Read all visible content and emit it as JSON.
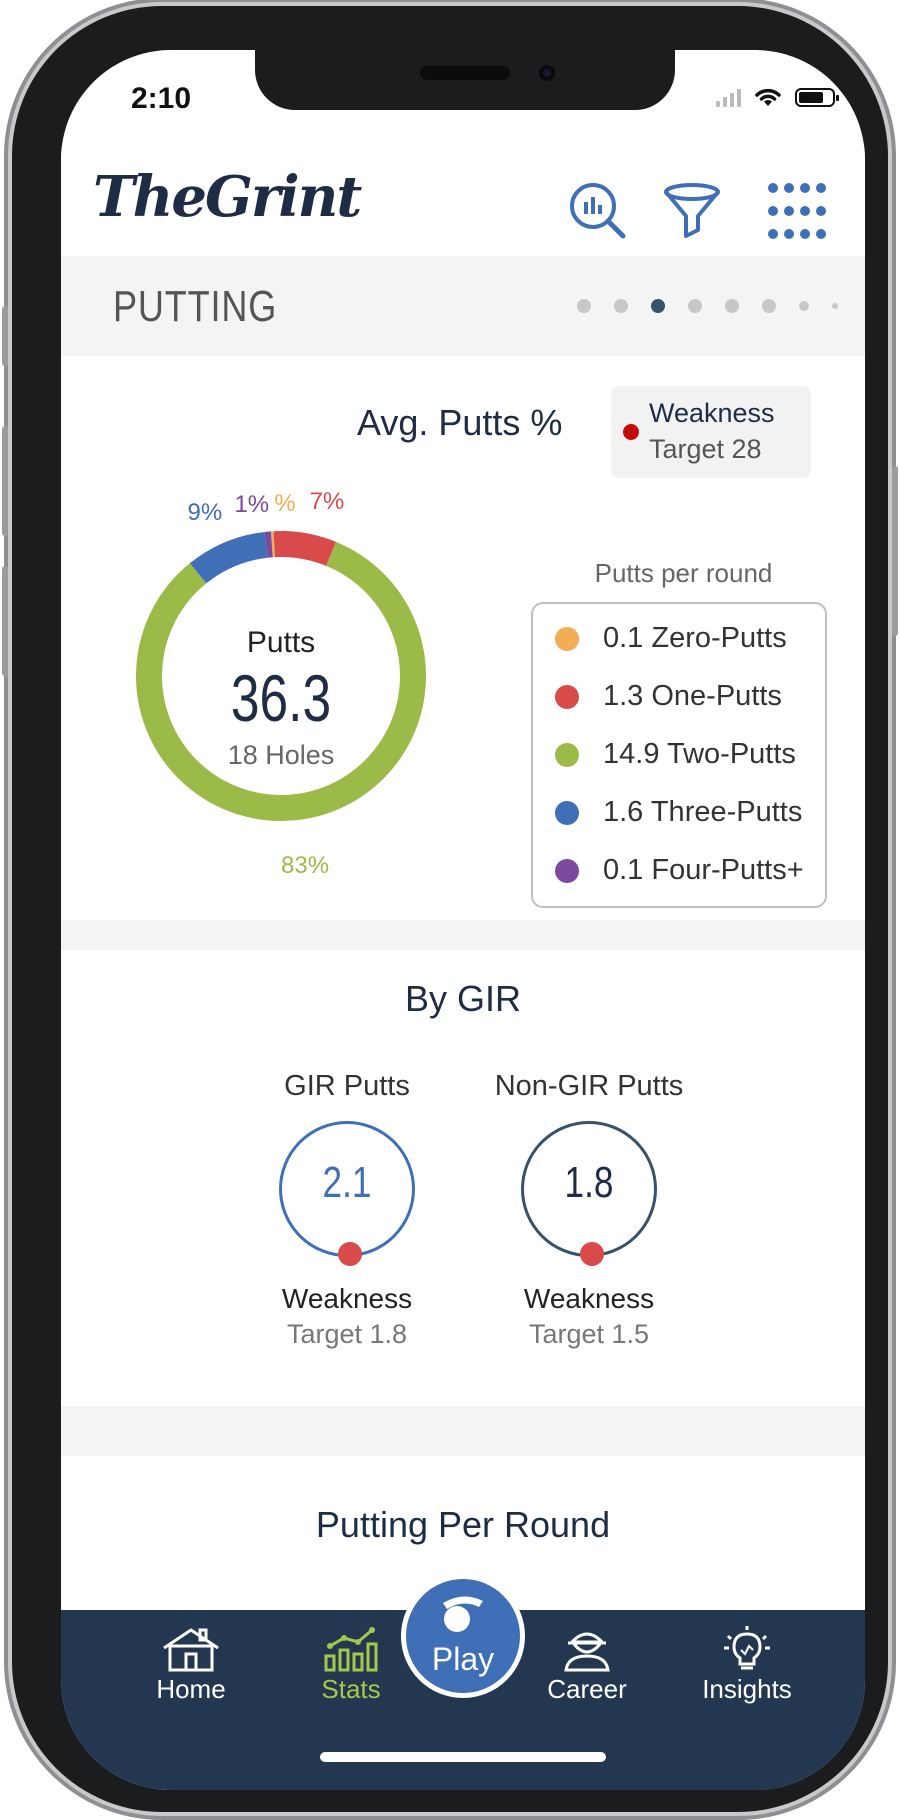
{
  "status_bar": {
    "time": "2:10"
  },
  "app": {
    "logo": "TheGrint"
  },
  "section": {
    "title": "PUTTING",
    "page_count": 8,
    "active_page": 3
  },
  "avg_putts": {
    "title": "Avg. Putts %",
    "weakness_label": "Weakness",
    "weakness_target": "Target 28",
    "center_title": "Putts",
    "center_value": "36.3",
    "center_sub": "18 Holes",
    "legend_caption": "Putts per round",
    "legend": [
      {
        "label": "0.1 Zero-Putts",
        "color": "#f4ac55"
      },
      {
        "label": "1.3 One-Putts",
        "color": "#d94a4a"
      },
      {
        "label": "14.9 Two-Putts",
        "color": "#9cba48"
      },
      {
        "label": "1.6 Three-Putts",
        "color": "#3f6fb6"
      },
      {
        "label": "0.1 Four-Putts+",
        "color": "#7a4a9e"
      }
    ],
    "donut_segments": [
      {
        "name": "zero-putts",
        "pct": 0.3,
        "color": "#f4ac55",
        "label": "%"
      },
      {
        "name": "one-putts",
        "pct": 7,
        "color": "#d94a4a",
        "label": "7%"
      },
      {
        "name": "two-putts",
        "pct": 83,
        "color": "#9cba48",
        "label": "83%"
      },
      {
        "name": "three-putts",
        "pct": 9,
        "color": "#3f6fb6",
        "label": "9%"
      },
      {
        "name": "four-putts",
        "pct": 0.7,
        "color": "#7a4a9e",
        "label": "1%"
      }
    ]
  },
  "by_gir": {
    "title": "By GIR",
    "gir": {
      "label": "GIR Putts",
      "value": "2.1",
      "weakness_label": "Weakness",
      "target": "Target 1.8",
      "color": "#3f6fb6"
    },
    "non_gir": {
      "label": "Non-GIR Putts",
      "value": "1.8",
      "weakness_label": "Weakness",
      "target": "Target 1.5",
      "color": "#36536c"
    }
  },
  "putting_per_round": {
    "title": "Putting Per Round"
  },
  "tabbar": {
    "home": "Home",
    "stats": "Stats",
    "play": "Play",
    "career": "Career",
    "insights": "Insights",
    "active_color": "#a4c94a"
  }
}
